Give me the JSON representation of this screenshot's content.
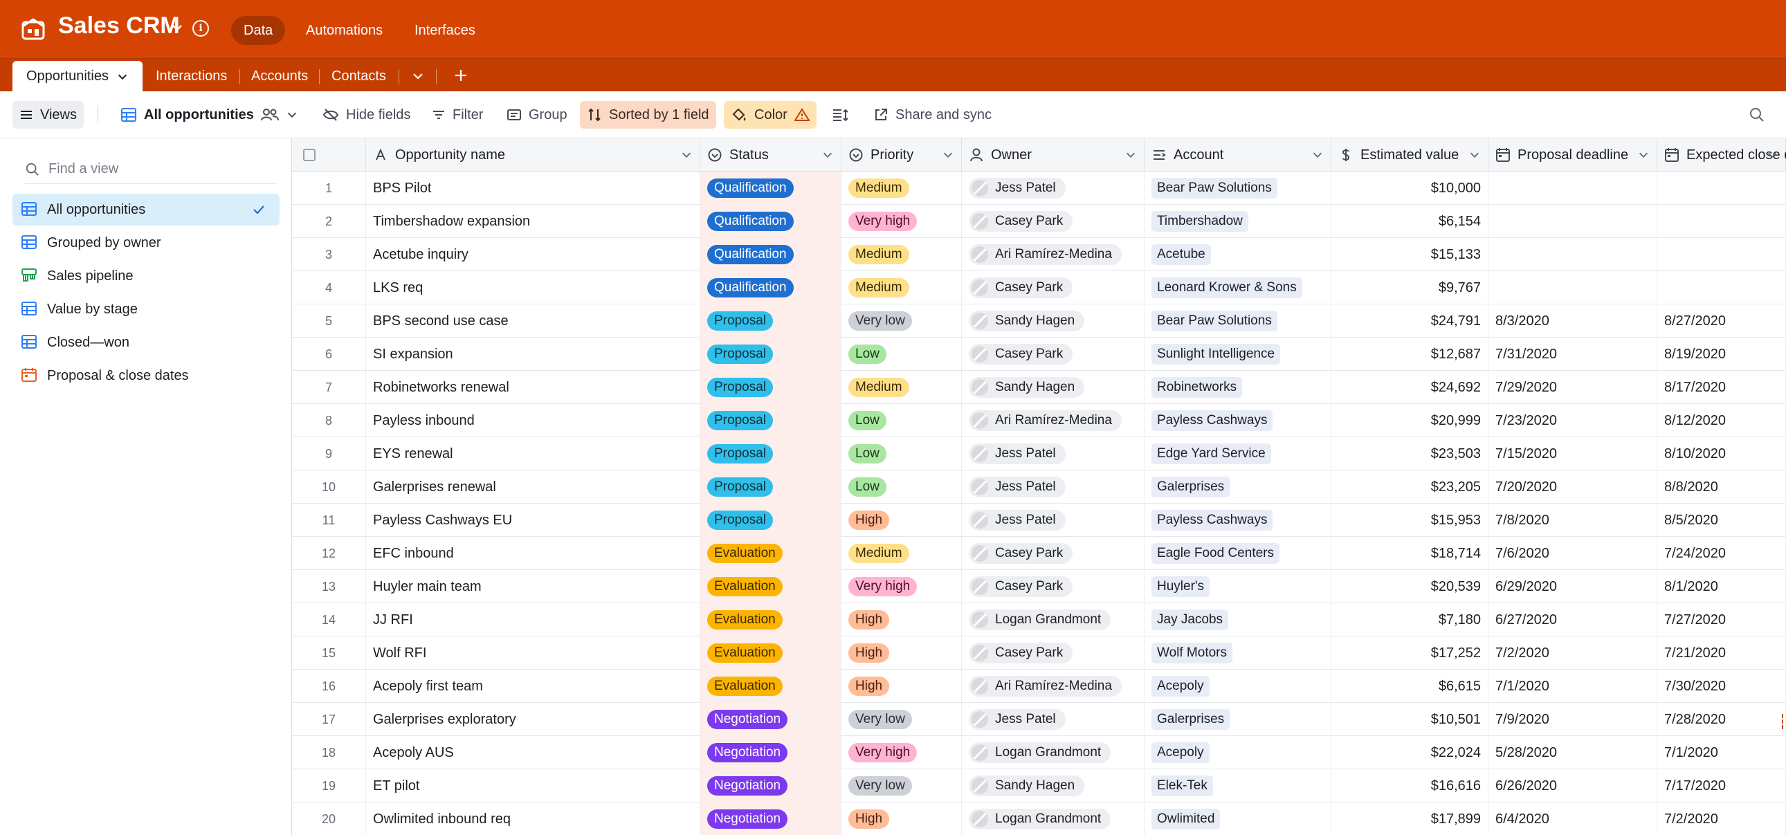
{
  "app": {
    "title": "Sales CRM",
    "brand_color": "#d54402",
    "nav": [
      {
        "label": "Data",
        "active": true
      },
      {
        "label": "Automations",
        "active": false
      },
      {
        "label": "Interfaces",
        "active": false
      }
    ]
  },
  "tabs": [
    {
      "label": "Opportunities",
      "active": true
    },
    {
      "label": "Interactions",
      "active": false
    },
    {
      "label": "Accounts",
      "active": false
    },
    {
      "label": "Contacts",
      "active": false
    }
  ],
  "toolbar": {
    "views_label": "Views",
    "current_view": "All opportunities",
    "hide_fields": "Hide fields",
    "filter": "Filter",
    "group": "Group",
    "sorted": "Sorted by 1 field",
    "color": "Color",
    "share": "Share and sync"
  },
  "sidebar": {
    "find_placeholder": "Find a view",
    "views": [
      {
        "label": "All opportunities",
        "icon": "grid-view-icon",
        "active": true
      },
      {
        "label": "Grouped by owner",
        "icon": "grid-view-icon",
        "active": false
      },
      {
        "label": "Sales pipeline",
        "icon": "kanban-view-icon",
        "active": false
      },
      {
        "label": "Value by stage",
        "icon": "grid-view-icon",
        "active": false
      },
      {
        "label": "Closed—won",
        "icon": "grid-view-icon",
        "active": false
      },
      {
        "label": "Proposal & close dates",
        "icon": "calendar-view-icon",
        "active": false
      }
    ]
  },
  "columns": [
    {
      "label": "Opportunity name",
      "icon": "text-field-icon"
    },
    {
      "label": "Status",
      "icon": "single-select-icon"
    },
    {
      "label": "Priority",
      "icon": "single-select-icon"
    },
    {
      "label": "Owner",
      "icon": "user-field-icon"
    },
    {
      "label": "Account",
      "icon": "link-field-icon"
    },
    {
      "label": "Estimated value",
      "icon": "currency-field-icon"
    },
    {
      "label": "Proposal deadline",
      "icon": "date-field-icon"
    },
    {
      "label": "Expected close date",
      "icon": "date-field-icon"
    }
  ],
  "status_colors": {
    "Qualification": {
      "bg": "#1f6fd0",
      "fg": "#ffffff"
    },
    "Proposal": {
      "bg": "#2fbfea",
      "fg": "#10323d"
    },
    "Evaluation": {
      "bg": "#fcb400",
      "fg": "#3a2a00"
    },
    "Negotiation": {
      "bg": "#7c39ed",
      "fg": "#ffffff"
    }
  },
  "priority_colors": {
    "Medium": {
      "bg": "#ffe08a",
      "fg": "#3a2a00"
    },
    "Very high": {
      "bg": "#ffb3d1",
      "fg": "#4a1027"
    },
    "Very low": {
      "bg": "#cdd0d5",
      "fg": "#2a2d33"
    },
    "Low": {
      "bg": "#a8e6a1",
      "fg": "#173a14"
    },
    "High": {
      "bg": "#ffbc96",
      "fg": "#4a2010"
    }
  },
  "rows": [
    {
      "n": "1",
      "name": "BPS Pilot",
      "status": "Qualification",
      "priority": "Medium",
      "owner": "Jess Patel",
      "account": "Bear Paw Solutions",
      "value": "$10,000",
      "proposal": "",
      "close": ""
    },
    {
      "n": "2",
      "name": "Timbershadow expansion",
      "status": "Qualification",
      "priority": "Very high",
      "owner": "Casey Park",
      "account": "Timbershadow",
      "value": "$6,154",
      "proposal": "",
      "close": ""
    },
    {
      "n": "3",
      "name": "Acetube inquiry",
      "status": "Qualification",
      "priority": "Medium",
      "owner": "Ari Ramírez-Medina",
      "account": "Acetube",
      "value": "$15,133",
      "proposal": "",
      "close": ""
    },
    {
      "n": "4",
      "name": "LKS req",
      "status": "Qualification",
      "priority": "Medium",
      "owner": "Casey Park",
      "account": "Leonard Krower & Sons",
      "value": "$9,767",
      "proposal": "",
      "close": ""
    },
    {
      "n": "5",
      "name": "BPS second use case",
      "status": "Proposal",
      "priority": "Very low",
      "owner": "Sandy Hagen",
      "account": "Bear Paw Solutions",
      "value": "$24,791",
      "proposal": "8/3/2020",
      "close": "8/27/2020"
    },
    {
      "n": "6",
      "name": "SI expansion",
      "status": "Proposal",
      "priority": "Low",
      "owner": "Casey Park",
      "account": "Sunlight Intelligence",
      "value": "$12,687",
      "proposal": "7/31/2020",
      "close": "8/19/2020"
    },
    {
      "n": "7",
      "name": "Robinetworks renewal",
      "status": "Proposal",
      "priority": "Medium",
      "owner": "Sandy Hagen",
      "account": "Robinetworks",
      "value": "$24,692",
      "proposal": "7/29/2020",
      "close": "8/17/2020"
    },
    {
      "n": "8",
      "name": "Payless inbound",
      "status": "Proposal",
      "priority": "Low",
      "owner": "Ari Ramírez-Medina",
      "account": "Payless Cashways",
      "value": "$20,999",
      "proposal": "7/23/2020",
      "close": "8/12/2020"
    },
    {
      "n": "9",
      "name": "EYS renewal",
      "status": "Proposal",
      "priority": "Low",
      "owner": "Jess Patel",
      "account": "Edge Yard Service",
      "value": "$23,503",
      "proposal": "7/15/2020",
      "close": "8/10/2020"
    },
    {
      "n": "10",
      "name": "Galerprises renewal",
      "status": "Proposal",
      "priority": "Low",
      "owner": "Jess Patel",
      "account": "Galerprises",
      "value": "$23,205",
      "proposal": "7/20/2020",
      "close": "8/8/2020"
    },
    {
      "n": "11",
      "name": "Payless Cashways EU",
      "status": "Proposal",
      "priority": "High",
      "owner": "Jess Patel",
      "account": "Payless Cashways",
      "value": "$15,953",
      "proposal": "7/8/2020",
      "close": "8/5/2020"
    },
    {
      "n": "12",
      "name": "EFC inbound",
      "status": "Evaluation",
      "priority": "Medium",
      "owner": "Casey Park",
      "account": "Eagle Food Centers",
      "value": "$18,714",
      "proposal": "7/6/2020",
      "close": "7/24/2020"
    },
    {
      "n": "13",
      "name": "Huyler main team",
      "status": "Evaluation",
      "priority": "Very high",
      "owner": "Casey Park",
      "account": "Huyler's",
      "value": "$20,539",
      "proposal": "6/29/2020",
      "close": "8/1/2020"
    },
    {
      "n": "14",
      "name": "JJ RFI",
      "status": "Evaluation",
      "priority": "High",
      "owner": "Logan Grandmont",
      "account": "Jay Jacobs",
      "value": "$7,180",
      "proposal": "6/27/2020",
      "close": "7/27/2020"
    },
    {
      "n": "15",
      "name": "Wolf RFI",
      "status": "Evaluation",
      "priority": "High",
      "owner": "Casey Park",
      "account": "Wolf Motors",
      "value": "$17,252",
      "proposal": "7/2/2020",
      "close": "7/21/2020"
    },
    {
      "n": "16",
      "name": "Acepoly first team",
      "status": "Evaluation",
      "priority": "High",
      "owner": "Ari Ramírez-Medina",
      "account": "Acepoly",
      "value": "$6,615",
      "proposal": "7/1/2020",
      "close": "7/30/2020"
    },
    {
      "n": "17",
      "name": "Galerprises exploratory",
      "status": "Negotiation",
      "priority": "Very low",
      "owner": "Jess Patel",
      "account": "Galerprises",
      "value": "$10,501",
      "proposal": "7/9/2020",
      "close": "7/28/2020"
    },
    {
      "n": "18",
      "name": "Acepoly AUS",
      "status": "Negotiation",
      "priority": "Very high",
      "owner": "Logan Grandmont",
      "account": "Acepoly",
      "value": "$22,024",
      "proposal": "5/28/2020",
      "close": "7/1/2020"
    },
    {
      "n": "19",
      "name": "ET pilot",
      "status": "Negotiation",
      "priority": "Very low",
      "owner": "Sandy Hagen",
      "account": "Elek-Tek",
      "value": "$16,616",
      "proposal": "6/26/2020",
      "close": "7/17/2020"
    },
    {
      "n": "20",
      "name": "Owlimited inbound req",
      "status": "Negotiation",
      "priority": "High",
      "owner": "Logan Grandmont",
      "account": "Owlimited",
      "value": "$17,899",
      "proposal": "6/4/2020",
      "close": "7/2/2020"
    }
  ]
}
